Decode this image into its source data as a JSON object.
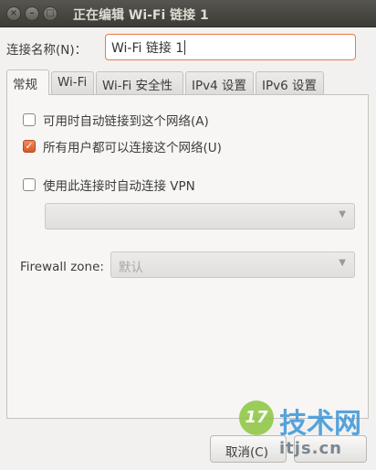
{
  "window": {
    "title": "正在编辑 Wi-Fi 链接 1",
    "close_glyph": "×",
    "minimize_glyph": "–",
    "maximize_glyph": "□"
  },
  "connection": {
    "name_label": "连接名称(N)：",
    "name_value": "Wi-Fi 链接 1"
  },
  "tabs": [
    {
      "label": "常规",
      "active": true
    },
    {
      "label": "Wi-Fi",
      "active": false
    },
    {
      "label": "Wi-Fi 安全性",
      "active": false
    },
    {
      "label": "IPv4 设置",
      "active": false
    },
    {
      "label": "IPv6 设置",
      "active": false
    }
  ],
  "general": {
    "auto_connect": {
      "label": "可用时自动链接到这个网络(A)",
      "checked": false
    },
    "all_users": {
      "label": "所有用户都可以连接这个网络(U)",
      "checked": true,
      "glyph": "✓"
    },
    "auto_vpn": {
      "label": "使用此连接时自动连接 VPN",
      "checked": false
    },
    "vpn_select": {
      "value": "",
      "arrow": "▼"
    },
    "firewall_label": "Firewall zone:",
    "firewall_select": {
      "value": "默认",
      "arrow": "▼"
    }
  },
  "buttons": {
    "cancel_label": "取消(C)"
  },
  "watermark": {
    "logo_text": "17",
    "brand_text": "技术网",
    "url_text": "itjs.cn"
  },
  "colors": {
    "accent": "#f07746",
    "checkbox_checked": "#dd5f30",
    "titlebar": "#3c3b37"
  }
}
